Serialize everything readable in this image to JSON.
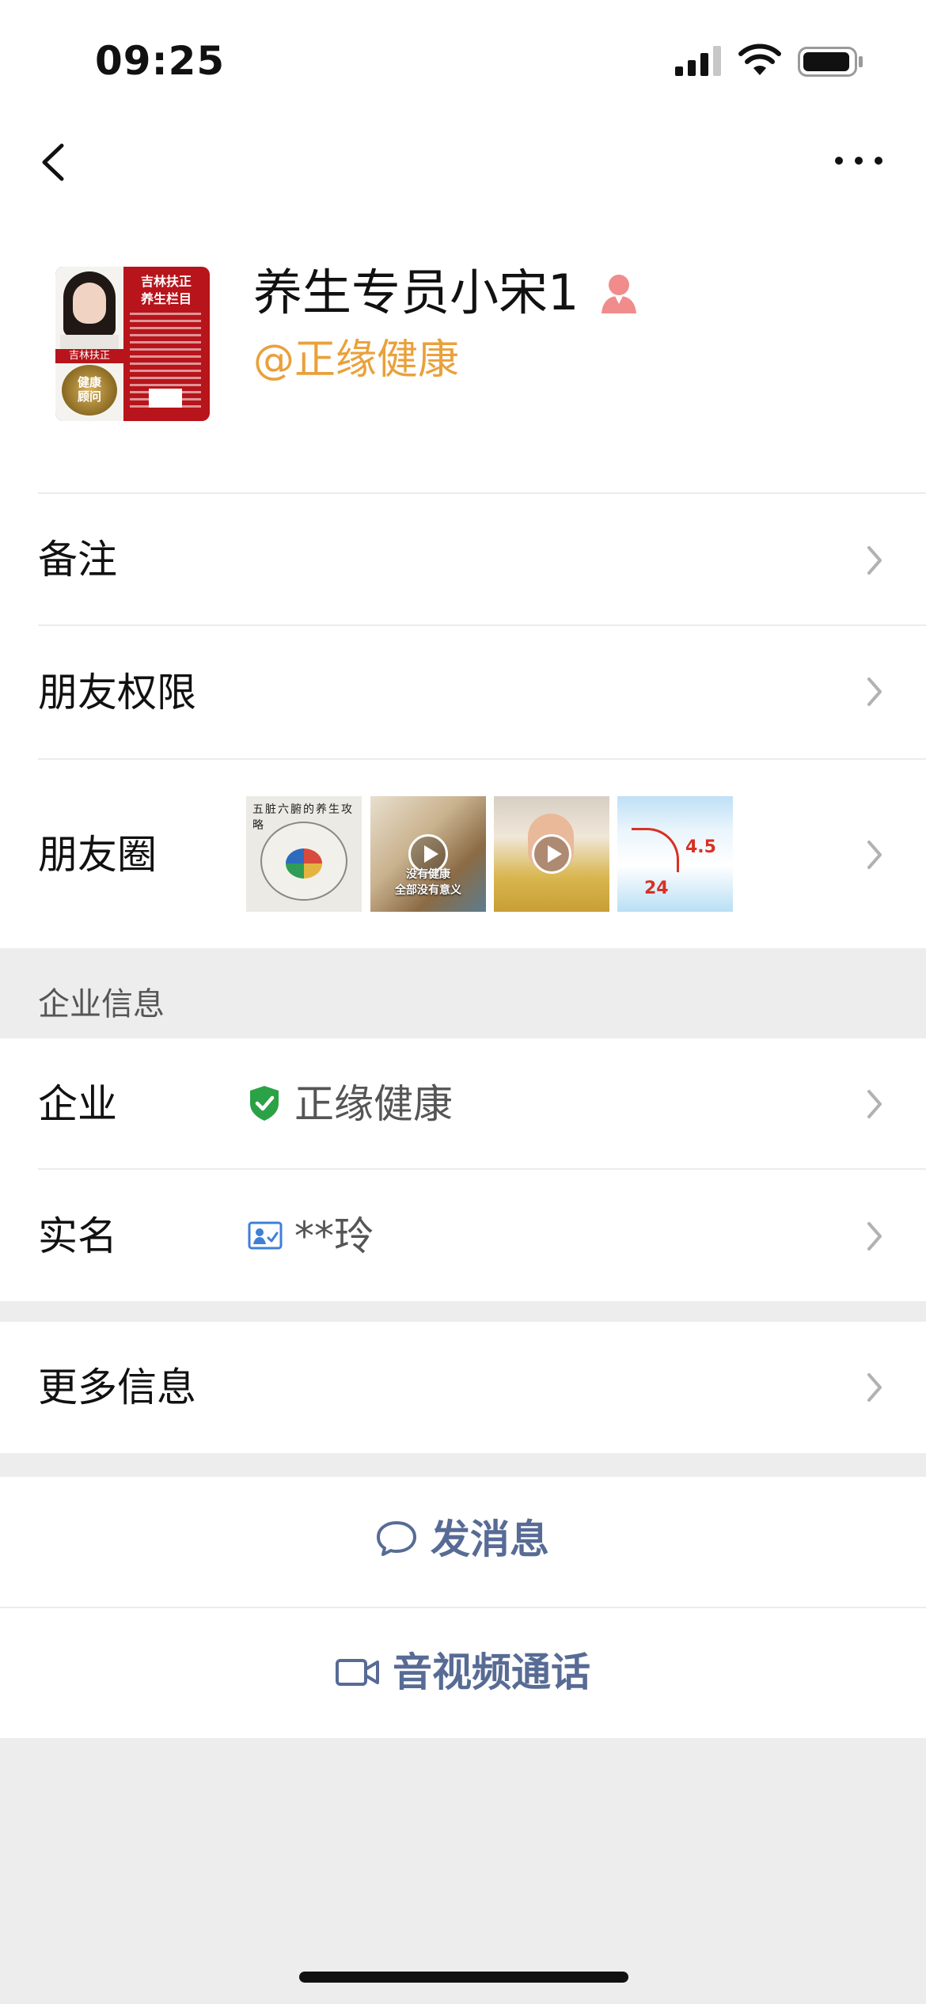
{
  "status_bar": {
    "time": "09:25"
  },
  "profile": {
    "name": "养生专员小宋1",
    "company_tag": "@正缘健康",
    "avatar": {
      "title": "吉林扶正\n养生栏目",
      "tag": "吉林扶正",
      "medal": "健康\n顾问"
    }
  },
  "rows": {
    "remark": "备注",
    "permissions": "朋友权限",
    "moments": "朋友圈"
  },
  "moments_thumbs": {
    "t1_title": "五脏六腑的养生攻略",
    "t2_caption": "没有健康\n全部没有意义",
    "t4_num1": "4.5",
    "t4_num2": "24"
  },
  "enterprise_section": {
    "title": "企业信息",
    "company_label": "企业",
    "company_value": "正缘健康",
    "realname_label": "实名",
    "realname_value": "**玲"
  },
  "more_info": "更多信息",
  "actions": {
    "message": "发消息",
    "call": "音视频通话"
  },
  "colors": {
    "accent_orange": "#e9a13b",
    "link_blue": "#576b95",
    "verified_green": "#2ba245",
    "background_gray": "#ededed"
  }
}
